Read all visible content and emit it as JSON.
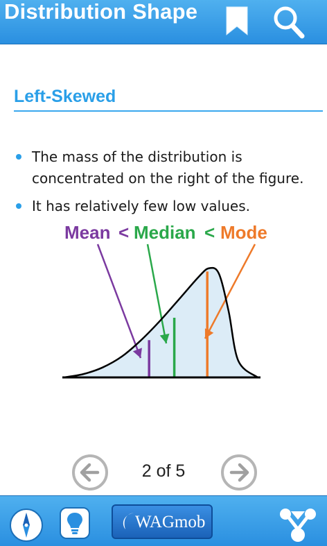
{
  "header": {
    "title": "Distribution Shape",
    "bookmark_icon": "bookmark-icon",
    "search_icon": "search-icon"
  },
  "section": {
    "title": "Left-Skewed"
  },
  "bullets": [
    "The mass of the distribution is concentrated on the right of the figure.",
    "It has relatively few low values."
  ],
  "chart_data": {
    "type": "area",
    "title": "",
    "labels": [
      {
        "text": "Mean",
        "color": "#7b3aa0"
      },
      {
        "text": "<",
        "color": "#7b3aa0"
      },
      {
        "text": "Median",
        "color": "#2aa84a"
      },
      {
        "text": "<",
        "color": "#2aa84a"
      },
      {
        "text": "Mode",
        "color": "#ee7a2a"
      }
    ],
    "x": [
      0,
      0.1,
      0.2,
      0.3,
      0.4,
      0.5,
      0.6,
      0.7,
      0.75,
      0.8,
      0.85,
      0.9,
      1.0
    ],
    "y": [
      0,
      0.03,
      0.09,
      0.19,
      0.34,
      0.52,
      0.72,
      0.92,
      0.99,
      0.94,
      0.6,
      0.15,
      0
    ],
    "markers": {
      "mean": 0.44,
      "median": 0.57,
      "mode": 0.74
    },
    "colors": {
      "fill": "#dcecf7",
      "curve": "#000000",
      "mean": "#7b3aa0",
      "median": "#2aa84a",
      "mode": "#ee7a2a"
    }
  },
  "pager": {
    "text": "2 of 5",
    "prev_icon": "arrow-left-icon",
    "next_icon": "arrow-right-icon"
  },
  "footer": {
    "compass_icon": "compass-icon",
    "bulb_icon": "lightbulb-icon",
    "brand_label": "WAGmob",
    "share_icon": "share-icon"
  },
  "colors": {
    "bar": "#2a8fe0",
    "accent": "#2a9fe8"
  }
}
